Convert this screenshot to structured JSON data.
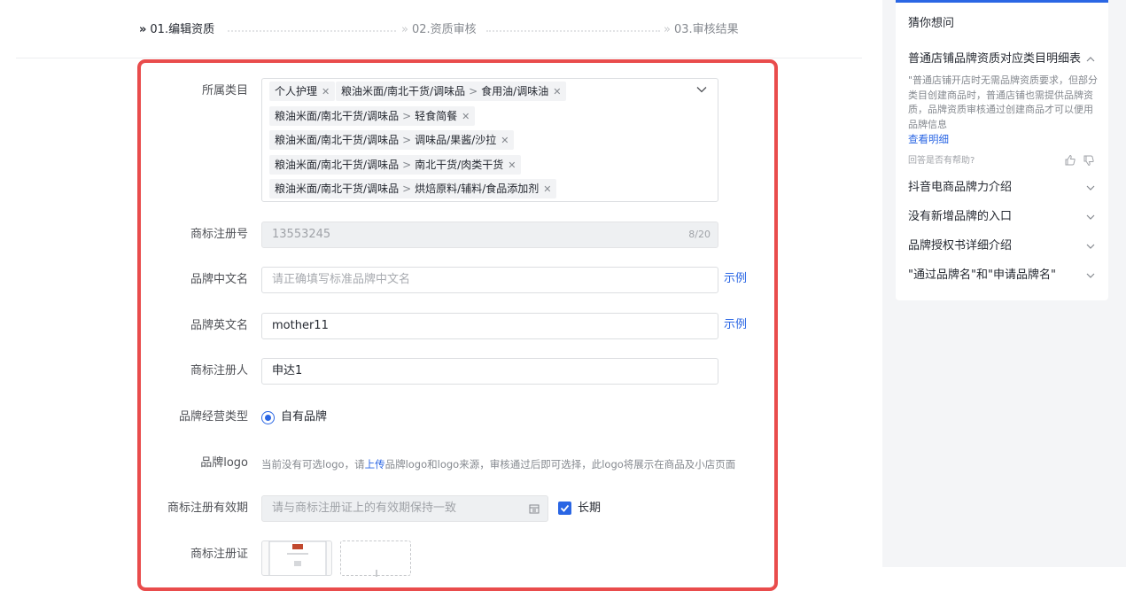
{
  "steps": [
    {
      "label": "01.编辑资质",
      "state": "active"
    },
    {
      "label": "02.资质审核",
      "state": "inactive"
    },
    {
      "label": "03.审核结果",
      "state": "inactive"
    }
  ],
  "form": {
    "category_label": "所属类目",
    "categories": [
      {
        "parts": [
          "个人护理"
        ]
      },
      {
        "parts": [
          "粮油米面/南北干货/调味品",
          "食用油/调味油"
        ]
      },
      {
        "parts": [
          "粮油米面/南北干货/调味品",
          "轻食简餐"
        ]
      },
      {
        "parts": [
          "粮油米面/南北干货/调味品",
          "调味品/果酱/沙拉"
        ]
      },
      {
        "parts": [
          "粮油米面/南北干货/调味品",
          "南北干货/肉类干货"
        ]
      },
      {
        "parts": [
          "粮油米面/南北干货/调味品",
          "烘焙原料/辅料/食品添加剂"
        ]
      }
    ],
    "trademark_no_label": "商标注册号",
    "trademark_no_value": "13553245",
    "trademark_no_counter": "8/20",
    "brand_cn_label": "品牌中文名",
    "brand_cn_placeholder": "请正确填写标准品牌中文名",
    "brand_en_label": "品牌英文名",
    "brand_en_value": "mother11",
    "example_link": "示例",
    "registrant_label": "商标注册人",
    "registrant_value": "申达1",
    "operation_type_label": "品牌经营类型",
    "operation_type_option": "自有品牌",
    "logo_label": "品牌logo",
    "logo_hint_prefix": "当前没有可选logo，请",
    "logo_hint_link": "上传",
    "logo_hint_suffix": "品牌logo和logo来源，审核通过后即可选择，此logo将展示在商品及小店页面",
    "validity_label": "商标注册有效期",
    "validity_placeholder": "请与商标注册证上的有效期保持一致",
    "long_term_label": "长期",
    "certificate_label": "商标注册证"
  },
  "side_panel": {
    "title": "猜你想问",
    "faqs": [
      {
        "question": "普通店铺品牌资质对应类目明细表",
        "expanded": true
      },
      {
        "question": "抖音电商品牌力介绍",
        "expanded": false
      },
      {
        "question": "没有新增品牌的入口",
        "expanded": false
      },
      {
        "question": "品牌授权书详细介绍",
        "expanded": false
      },
      {
        "question": "\"通过品牌名\"和\"申请品牌名\"",
        "expanded": false
      }
    ],
    "expanded_answer": "\"普通店铺开店时无需品牌资质要求，但部分类目创建商品时，普通店铺也需提供品牌资质，品牌资质审核通过创建商品才可以便用品牌信息",
    "view_detail": "查看明细",
    "helpful_question": "回答是否有帮助?"
  },
  "colors": {
    "accent": "#2a66e4",
    "highlight_frame": "#e94c4c"
  }
}
